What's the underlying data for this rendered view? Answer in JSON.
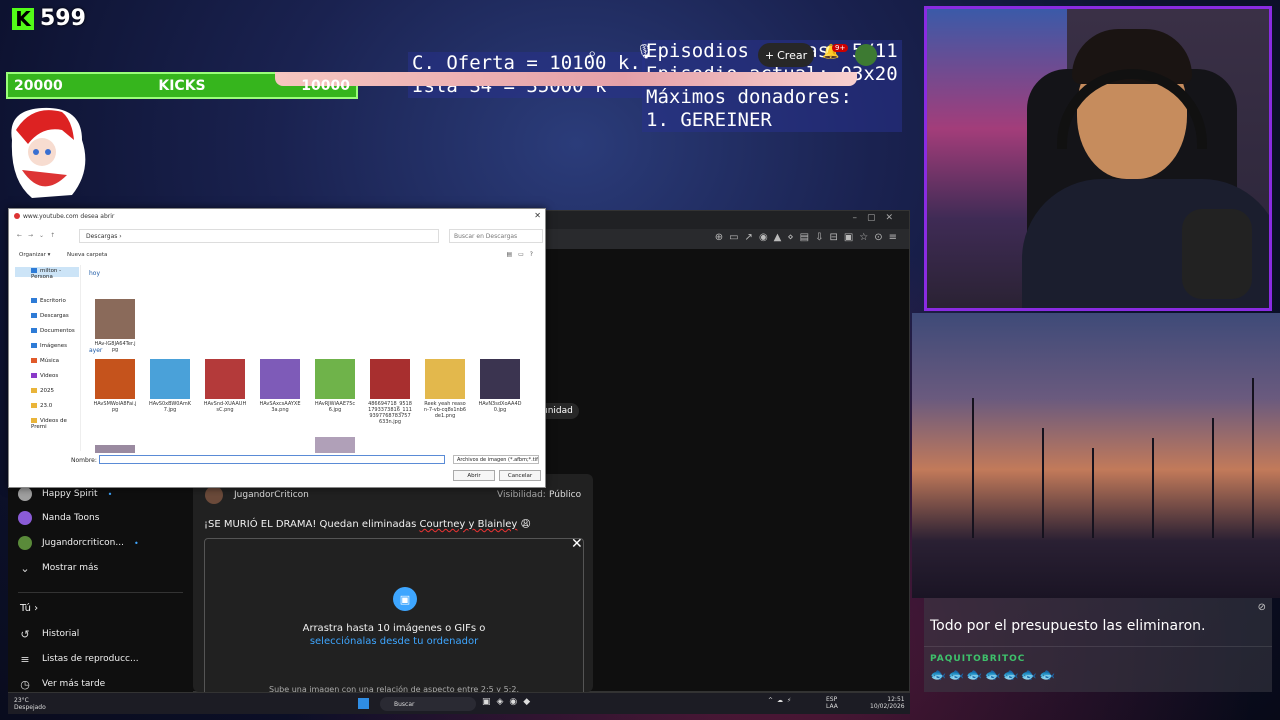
{
  "kick": {
    "count": "599",
    "bar_left": "20000",
    "bar_label": "KICKS",
    "bar_right": "10000"
  },
  "overlay": {
    "left_lines": [
      "C. Oferta = 10100 k.",
      "Isla S4 = 35000 k"
    ],
    "right_lines": [
      "Episodios extras: 5/11",
      "Episodio actual: 03x20",
      "Máximos donadores:",
      "1. GEREINER"
    ]
  },
  "chat": {
    "user1": "",
    "msg1": "Todo por el presupuesto las eliminaron.",
    "user2": "PAQUITOBRITOC",
    "emotes": "🐟🐟🐟🐟🐟🐟🐟"
  },
  "youtube": {
    "create_label": "Crear",
    "notif_badge": "9+",
    "comunidad": "unidad",
    "sidebar": {
      "subs": [
        {
          "name": "Happy Spirit",
          "color": "#a0a0a0"
        },
        {
          "name": "Nanda Toons",
          "color": "#8a5bd6"
        },
        {
          "name": "Jugandorcriticon...",
          "color": "#5a8a3a"
        }
      ],
      "show_more": "Mostrar más",
      "you_heading": "Tú ›",
      "items": [
        {
          "label": "Historial",
          "icon": "history-icon"
        },
        {
          "label": "Listas de reproducc...",
          "icon": "playlist-icon"
        },
        {
          "label": "Ver más tarde",
          "icon": "clock-icon"
        }
      ]
    },
    "post": {
      "user": "JugandorCriticon",
      "visibility_label": "Visibilidad:",
      "visibility_value": "Público",
      "text_prefix": "¡SE MURIÓ EL DRAMA! Quedan eliminadas ",
      "text_names": "Courtney y Blainley",
      "text_emoji": " 😩",
      "upload_line1": "Arrastra hasta 10 imágenes o GIFs o",
      "upload_line2": "selecciónalas desde tu ordenador",
      "upload_hint": "Sube una imagen con una relación de aspecto entre 2:5 y 5:2."
    }
  },
  "dialog": {
    "title": "www.youtube.com desea abrir",
    "path": "Descargas  ›",
    "search_placeholder": "Buscar en Descargas",
    "organize": "Organizar ▾",
    "new_folder": "Nueva carpeta",
    "tree": [
      {
        "label": "milton - Persona"
      },
      {
        "label": "Escritorio"
      },
      {
        "label": "Descargas"
      },
      {
        "label": "Documentos"
      },
      {
        "label": "Imágenes"
      },
      {
        "label": "Música"
      },
      {
        "label": "Videos"
      },
      {
        "label": "2025"
      },
      {
        "label": "23.0"
      },
      {
        "label": "Videos de Premi"
      }
    ],
    "group_today": "hoy",
    "group_yesterday": "ayer",
    "today_files": [
      {
        "name": "HAv-lG8JA64Ter.jpg",
        "color": "#8a6a5a"
      }
    ],
    "yesterday_files": [
      {
        "name": "HAvSMWolA8Fai.jpg",
        "color": "#c5531c"
      },
      {
        "name": "HAvS0xBW0AmK7.jpg",
        "color": "#4aa1d9"
      },
      {
        "name": "HAvSnd-XUAAUHsC.png",
        "color": "#b43a3a"
      },
      {
        "name": "HAvSAxcsAAYXE3a.png",
        "color": "#7e5bb8"
      },
      {
        "name": "HAvRJWiAAE75c6.jpg",
        "color": "#6fb34a"
      },
      {
        "name": "486694718_95181793373816_1119397768783757633n.jpg",
        "color": "#a82f2f"
      },
      {
        "name": "Reek yeah reason-7-vb-cq8s1nb6de1.png",
        "color": "#e3b84c"
      },
      {
        "name": "HAvN3sdXoAA4D0.jpg",
        "color": "#3b3450"
      }
    ],
    "name_label": "Nombre:",
    "type_filter": "Archivos de imagen (*.afbm;*.tif",
    "open_button": "Abrir",
    "cancel_button": "Cancelar"
  },
  "taskbar": {
    "temp": "23°C",
    "weather": "Despejado",
    "search": "Buscar",
    "lang1": "ESP",
    "lang2": "LAA",
    "time": "12:51",
    "date": "10/02/2026"
  }
}
